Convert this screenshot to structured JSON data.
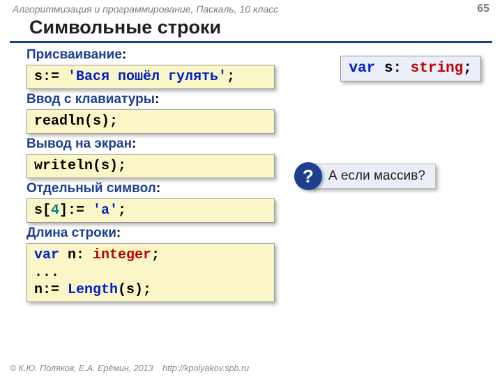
{
  "header": {
    "course": "Алгоритмизация и программирование, Паскаль, 10 класс",
    "page": "65"
  },
  "title": "Символьные строки",
  "decl": {
    "var": "var",
    "s_colon": " s: ",
    "type": "string",
    "semi": ";"
  },
  "sections": {
    "assign": {
      "label": "Присваивание",
      "colon": ":"
    },
    "input": {
      "label": "Ввод с клавиатуры",
      "colon": ":"
    },
    "output": {
      "label": "Вывод на экран",
      "colon": ":"
    },
    "char": {
      "label": "Отдельный символ",
      "colon": ":"
    },
    "len": {
      "label": "Длина строки",
      "colon": ":"
    }
  },
  "code": {
    "assign": {
      "l": "s:= ",
      "str": "'Вася пошёл гулять'",
      "r": ";"
    },
    "input": {
      "t": "readln(s);"
    },
    "output": {
      "t": "writeln(s);"
    },
    "char": {
      "a": "s[",
      "idx": "4",
      "b": "]:= ",
      "val": "'a'",
      "c": ";"
    },
    "len": {
      "l1a": "var",
      "l1b": " n: ",
      "l1c": "integer",
      "l1d": ";",
      "l2": "...",
      "l3a": "n:= ",
      "l3b": "Length",
      "l3c": "(s);"
    }
  },
  "callout": {
    "q": "?",
    "text": "А если массив?"
  },
  "footer": {
    "copy": "© К.Ю. Поляков, Е.А. Ерёмин, 2013",
    "url": "http://kpolyakov.spb.ru"
  }
}
